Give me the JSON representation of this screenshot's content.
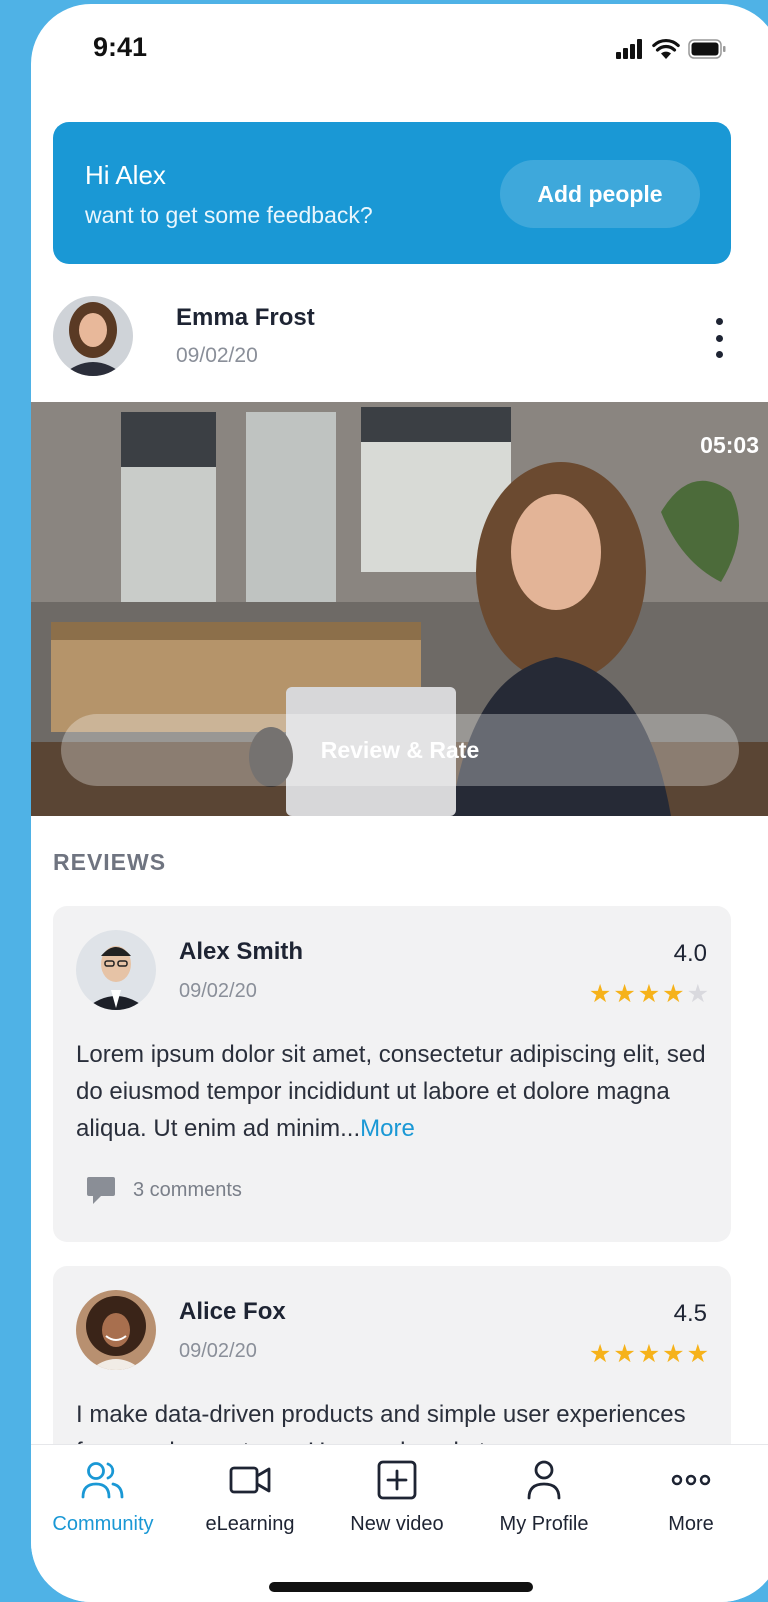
{
  "status_bar": {
    "time": "9:41"
  },
  "banner": {
    "title": "Hi Alex",
    "subtitle": "want to get some feedback?",
    "button": "Add people"
  },
  "post": {
    "author": "Emma Frost",
    "date": "09/02/20",
    "video_duration": "05:03",
    "review_button": "Review & Rate"
  },
  "reviews": {
    "heading": "REVIEWS",
    "items": [
      {
        "name": "Alex Smith",
        "date": "09/02/20",
        "rating": "4.0",
        "stars_filled": 4,
        "text": "Lorem ipsum dolor sit amet, consectetur adipiscing elit, sed do eiusmod tempor incididunt ut labore et dolore magna aliqua. Ut enim ad minim...",
        "more": "More",
        "comments": "3 comments"
      },
      {
        "name": "Alice Fox",
        "date": "09/02/20",
        "rating": "4.5",
        "stars_filled": 5,
        "text": "I make data-driven products and simple user experiences for complex systems. User and market"
      }
    ]
  },
  "tabbar": {
    "items": [
      {
        "label": "Community",
        "icon": "community-icon",
        "active": true
      },
      {
        "label": "eLearning",
        "icon": "video-camera-icon"
      },
      {
        "label": "New video",
        "icon": "plus-square-icon"
      },
      {
        "label": "My Profile",
        "icon": "user-icon"
      },
      {
        "label": "More",
        "icon": "more-dots-icon"
      }
    ]
  },
  "colors": {
    "accent": "#1a98d5",
    "star": "#f6b21a",
    "star_empty": "#d9d9de",
    "background": "#4fb2e6"
  }
}
